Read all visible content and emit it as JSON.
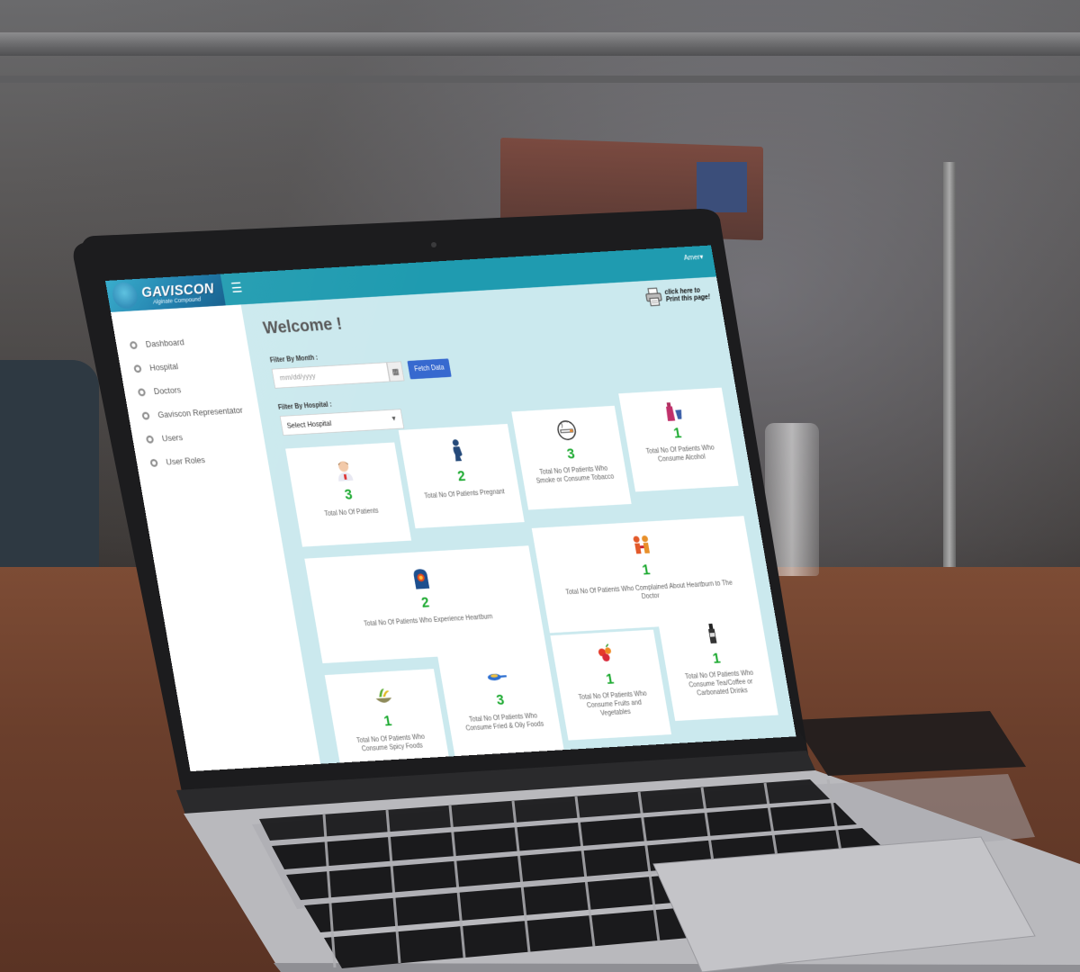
{
  "brand": {
    "name": "GAVISCON",
    "tagline": "Alginate Compound"
  },
  "topbar": {
    "user_menu": "Amer▾"
  },
  "sidebar": {
    "items": [
      {
        "label": "Dashboard"
      },
      {
        "label": "Hospital"
      },
      {
        "label": "Doctors"
      },
      {
        "label": "Gaviscon Representator"
      },
      {
        "label": "Users"
      },
      {
        "label": "User Roles"
      }
    ]
  },
  "print": {
    "line1": "click here to",
    "line2": "Print this page!"
  },
  "main": {
    "title": "Welcome !",
    "filter_month_label": "Filter By Month :",
    "date_placeholder": "mm/dd/yyyy",
    "fetch_button": "Fetch Data",
    "filter_hospital_label": "Filter By Hospital :",
    "hospital_selected": "Select Hospital"
  },
  "colors": {
    "topbar": "#1f9bb0",
    "content_bg": "#cbe9ee",
    "count_green": "#1daa31",
    "fetch_button": "#3769cf"
  },
  "cards": [
    {
      "icon": "nurse-icon",
      "value": "3",
      "label": "Total No Of Patients"
    },
    {
      "icon": "pregnant-icon",
      "value": "2",
      "label": "Total No Of Patients Pregnant"
    },
    {
      "icon": "smoking-icon",
      "value": "3",
      "label": "Total No Of Patients Who Smoke or Consume Tobacco"
    },
    {
      "icon": "alcohol-icon",
      "value": "1",
      "label": "Total No Of Patients Who Consume Alcohol"
    },
    {
      "icon": "heartburn-icon",
      "value": "2",
      "label": "Total No Of Patients Who Experience Heartburn"
    },
    {
      "icon": "doctor-complaint-icon",
      "value": "1",
      "label": "Total No Of Patients Who Complained About Heartburn to The Doctor"
    },
    {
      "icon": "spicy-food-icon",
      "value": "1",
      "label": "Total No Of Patients Who Consume Spicy Foods"
    },
    {
      "icon": "fried-food-icon",
      "value": "3",
      "label": "Total No Of Patients Who Consume Fried & Oily Foods"
    },
    {
      "icon": "fruits-icon",
      "value": "1",
      "label": "Total No Of Patients Who Consume Fruits and Vegetables"
    },
    {
      "icon": "coffee-icon",
      "value": "1",
      "label": "Total No Of Patients Who Consume Tea/Coffee or Carbonated Drinks"
    }
  ]
}
